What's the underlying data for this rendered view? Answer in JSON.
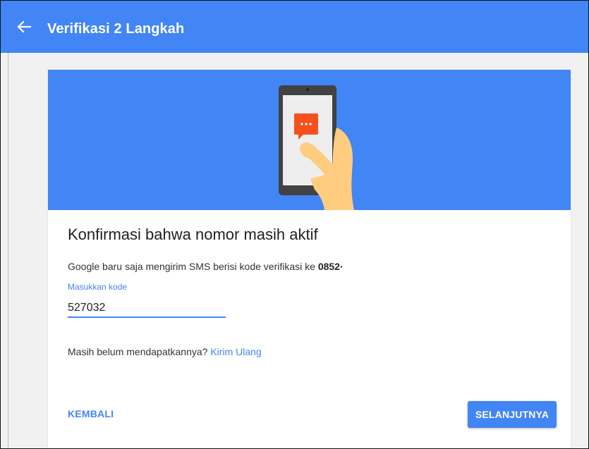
{
  "header": {
    "title": "Verifikasi 2 Langkah",
    "back_icon": "arrow-left-icon"
  },
  "hero": {
    "illustration_icon": "phone-sms-icon",
    "colors": {
      "background": "#4285f4",
      "bubble": "#f4511e",
      "hand": "#ffcc80"
    }
  },
  "content": {
    "heading": "Konfirmasi bahwa nomor masih aktif",
    "description_prefix": "Google baru saja mengirim SMS berisi kode verifikasi ke ",
    "phone_number": "0852·",
    "input_label": "Masukkan kode",
    "input_value": "527032",
    "resend_prefix": "Masih belum mendapatkannya? ",
    "resend_link": "Kirim Ulang"
  },
  "actions": {
    "back_label": "KEMBALI",
    "next_label": "SELANJUTNYA"
  },
  "colors": {
    "accent": "#4285f4",
    "page_background": "#f1f1f1"
  }
}
